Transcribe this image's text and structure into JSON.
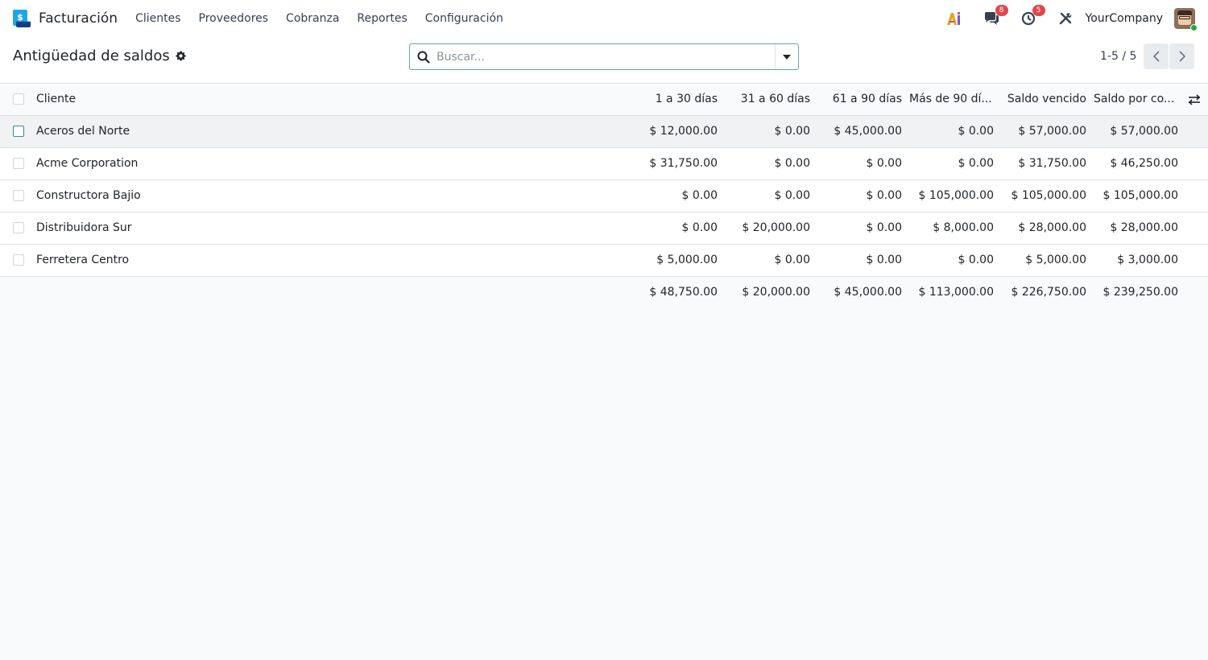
{
  "navbar": {
    "app_name": "Facturación",
    "menu": [
      "Clientes",
      "Proveedores",
      "Cobranza",
      "Reportes",
      "Configuración"
    ],
    "messages_count": "8",
    "activities_count": "5",
    "company": "YourCompany",
    "logo_symbol": "$"
  },
  "control_panel": {
    "title": "Antigüedad de saldos",
    "search_placeholder": "Buscar...",
    "pager": "1-5 / 5"
  },
  "table": {
    "columns": [
      "Cliente",
      "1 a 30 días",
      "31 a 60 días",
      "61 a 90 días",
      "Más de 90 dí...",
      "Saldo vencido",
      "Saldo por co..."
    ],
    "rows": [
      [
        "Aceros del Norte",
        "$ 12,000.00",
        "$ 0.00",
        "$ 45,000.00",
        "$ 0.00",
        "$ 57,000.00",
        "$ 57,000.00"
      ],
      [
        "Acme Corporation",
        "$ 31,750.00",
        "$ 0.00",
        "$ 0.00",
        "$ 0.00",
        "$ 31,750.00",
        "$ 46,250.00"
      ],
      [
        "Constructora Bajio",
        "$ 0.00",
        "$ 0.00",
        "$ 0.00",
        "$ 105,000.00",
        "$ 105,000.00",
        "$ 105,000.00"
      ],
      [
        "Distribuidora Sur",
        "$ 0.00",
        "$ 20,000.00",
        "$ 0.00",
        "$ 8,000.00",
        "$ 28,000.00",
        "$ 28,000.00"
      ],
      [
        "Ferretera Centro",
        "$ 5,000.00",
        "$ 0.00",
        "$ 0.00",
        "$ 0.00",
        "$ 5,000.00",
        "$ 3,000.00"
      ]
    ],
    "totals": [
      "$ 48,750.00",
      "$ 20,000.00",
      "$ 45,000.00",
      "$ 113,000.00",
      "$ 226,750.00",
      "$ 239,250.00"
    ]
  },
  "icons": {
    "ai": "ai-icon",
    "messages": "chat-icon",
    "activities": "clock-icon",
    "tools": "tools-icon",
    "gear": "gear-icon",
    "search": "search-icon",
    "dropdown": "caret-down-icon",
    "prev": "chevron-left-icon",
    "next": "chevron-right-icon",
    "columns": "sliders-icon"
  },
  "colors": {
    "accent": "#2f8f8b",
    "badge": "#e0474c",
    "online": "#28a745"
  }
}
